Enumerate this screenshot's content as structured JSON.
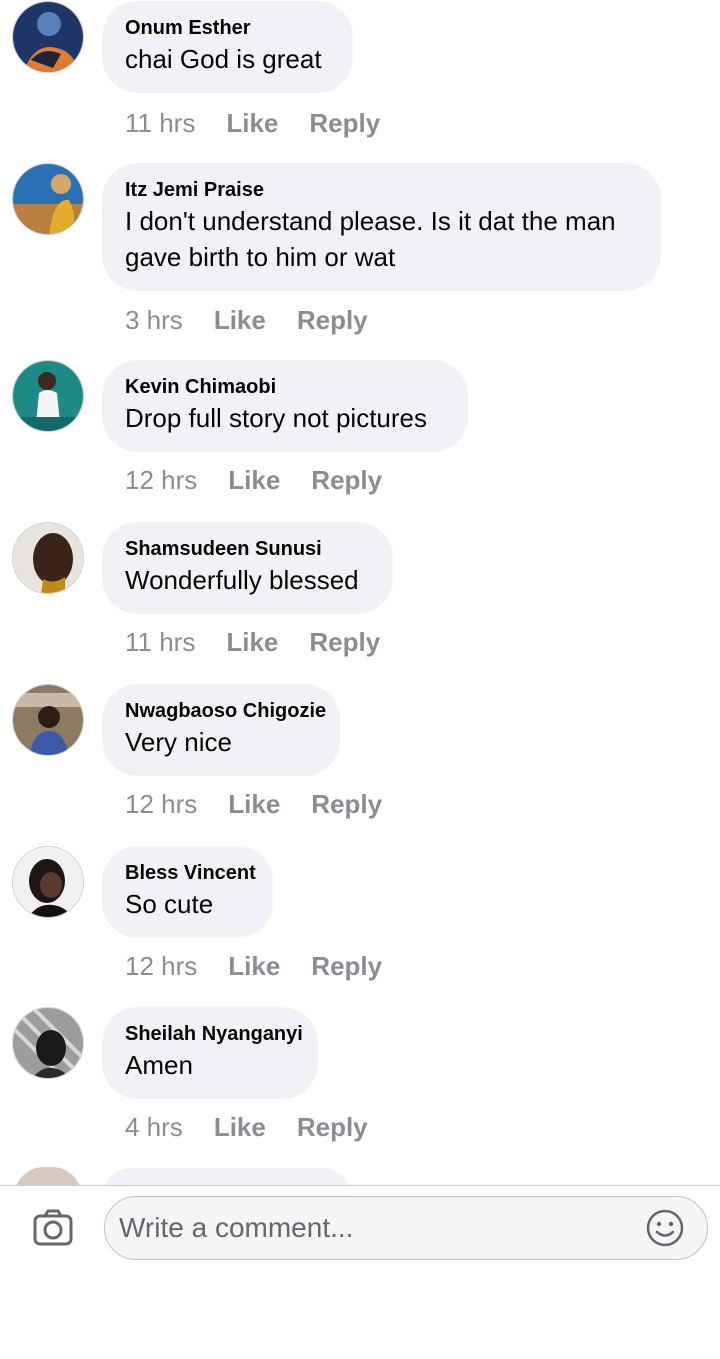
{
  "comments": [
    {
      "author": "Onum Esther",
      "text": "chai God is great",
      "time": "11 hrs",
      "like": "Like",
      "reply": "Reply"
    },
    {
      "author": "Itz Jemi Praise",
      "text": "I don't understand please. Is it dat the man gave birth to him or wat",
      "time": "3 hrs",
      "like": "Like",
      "reply": "Reply"
    },
    {
      "author": "Kevin Chimaobi",
      "text": "Drop full story not pictures",
      "time": "12 hrs",
      "like": "Like",
      "reply": "Reply"
    },
    {
      "author": "Shamsudeen Sunusi",
      "text": "Wonderfully blessed",
      "time": "11 hrs",
      "like": "Like",
      "reply": "Reply"
    },
    {
      "author": "Nwagbaoso Chigozie",
      "text": "Very nice",
      "time": "12 hrs",
      "like": "Like",
      "reply": "Reply"
    },
    {
      "author": "Bless Vincent",
      "text": "So cute",
      "time": "12 hrs",
      "like": "Like",
      "reply": "Reply"
    },
    {
      "author": "Sheilah Nyanganyi",
      "text": "Amen",
      "time": "4 hrs",
      "like": "Like",
      "reply": "Reply"
    }
  ],
  "composer": {
    "placeholder": "Write a comment...",
    "camera_icon": "camera-icon",
    "emoji_icon": "emoji-smiley-icon"
  },
  "colors": {
    "bubble": "#f0f2f5",
    "meta_text": "#8a8d91",
    "author_text": "#050505"
  }
}
